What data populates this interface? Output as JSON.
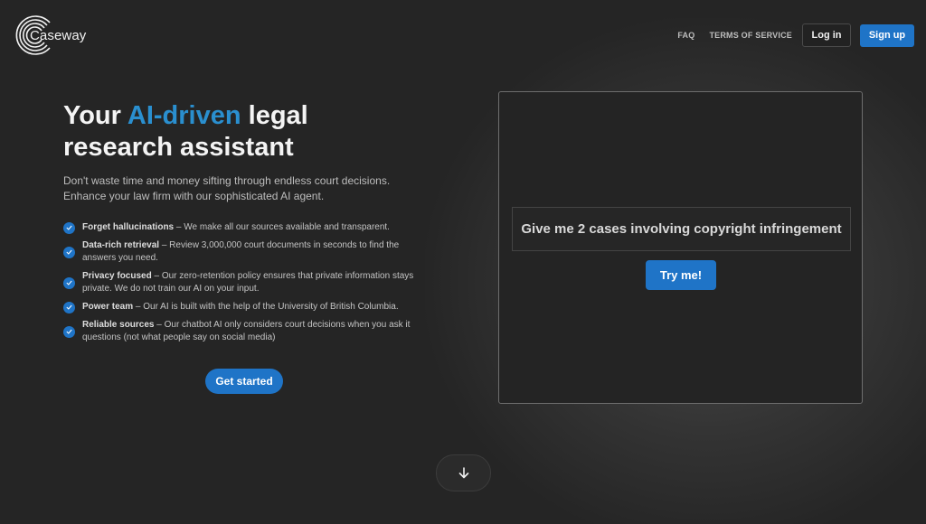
{
  "brand": {
    "name": "Caseway",
    "logo_icon": "concentric-c-logo-icon"
  },
  "nav": {
    "faq": "FAQ",
    "terms": "TERMS OF SERVICE",
    "login": "Log in",
    "signup": "Sign up"
  },
  "hero": {
    "title_before": "Your ",
    "title_accent": "AI-driven",
    "title_after": " legal",
    "title_line2": "research assistant",
    "subtitle": "Don't waste time and money sifting through endless court decisions. Enhance your law firm with our sophisticated AI agent.",
    "features": [
      {
        "title": "Forget hallucinations",
        "text": " – We make all our sources available and transparent."
      },
      {
        "title": "Data-rich retrieval",
        "text": " – Review 3,000,000 court documents in seconds to find the answers you need."
      },
      {
        "title": "Privacy focused",
        "text": " – Our zero-retention policy ensures that private information stays private. We do not train our AI on your input."
      },
      {
        "title": "Power team",
        "text": " – Our AI is built with the help of the University of British Columbia."
      },
      {
        "title": "Reliable sources",
        "text": " – Our chatbot AI only considers court decisions when you ask it questions (not what people say on social media)"
      }
    ],
    "cta": "Get started"
  },
  "demo": {
    "prompt": "Give me 2 cases involving copyright infringement",
    "try_button": "Try me!"
  },
  "scroll": {
    "icon": "arrow-down-icon"
  },
  "colors": {
    "accent": "#1f74c7",
    "accent_text": "#2a8fcf",
    "background": "#252525"
  }
}
